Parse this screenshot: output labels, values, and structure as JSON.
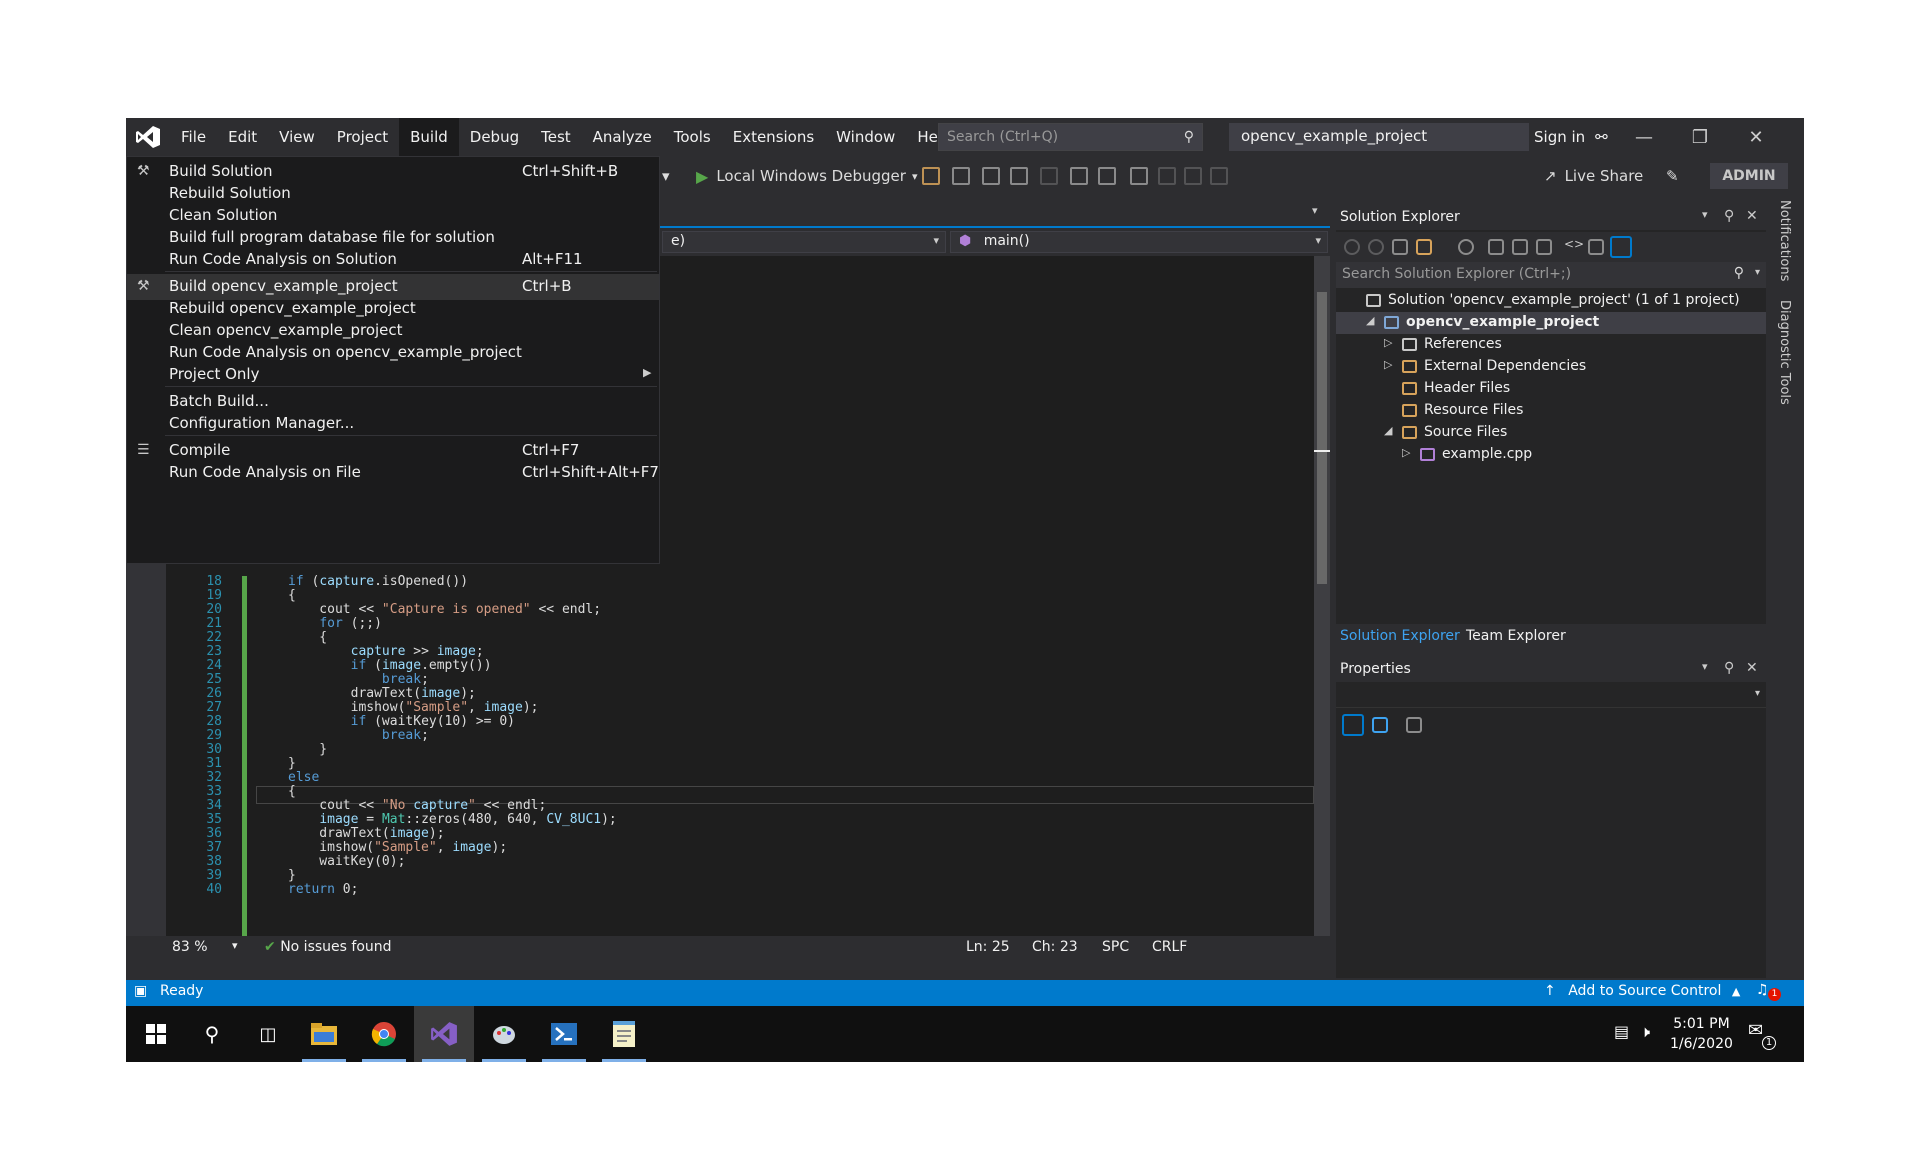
{
  "menubar": {
    "items": [
      "File",
      "Edit",
      "View",
      "Project",
      "Build",
      "Debug",
      "Test",
      "Analyze",
      "Tools",
      "Extensions",
      "Window",
      "Help"
    ],
    "search_placeholder": "Search (Ctrl+Q)",
    "project_name": "opencv_example_project",
    "sign_in": "Sign in"
  },
  "toolbar": {
    "debugger_label": "Local Windows Debugger",
    "live_share": "Live Share",
    "admin": "ADMIN"
  },
  "build_menu": {
    "items": [
      {
        "label": "Build Solution",
        "shortcut": "Ctrl+Shift+B"
      },
      {
        "label": "Rebuild Solution",
        "shortcut": ""
      },
      {
        "label": "Clean Solution",
        "shortcut": ""
      },
      {
        "label": "Build full program database file for solution",
        "shortcut": ""
      },
      {
        "label": "Run Code Analysis on Solution",
        "shortcut": "Alt+F11"
      },
      {
        "label": "Build opencv_example_project",
        "shortcut": "Ctrl+B"
      },
      {
        "label": "Rebuild opencv_example_project",
        "shortcut": ""
      },
      {
        "label": "Clean opencv_example_project",
        "shortcut": ""
      },
      {
        "label": "Run Code Analysis on opencv_example_project",
        "shortcut": ""
      },
      {
        "label": "Project Only",
        "shortcut": ""
      },
      {
        "label": "Batch Build...",
        "shortcut": ""
      },
      {
        "label": "Configuration Manager...",
        "shortcut": ""
      },
      {
        "label": "Compile",
        "shortcut": "Ctrl+F7"
      },
      {
        "label": "Run Code Analysis on File",
        "shortcut": "Ctrl+Shift+Alt+F7"
      }
    ]
  },
  "editor": {
    "nav_left": "e)",
    "nav_right": "main()",
    "code": [
      {
        "n": "18",
        "t": "if (capture.isOpened())"
      },
      {
        "n": "19",
        "t": "{"
      },
      {
        "n": "20",
        "t": "    cout << \"Capture is opened\" << endl;"
      },
      {
        "n": "21",
        "t": "    for (;;)"
      },
      {
        "n": "22",
        "t": "    {"
      },
      {
        "n": "23",
        "t": "        capture >> image;"
      },
      {
        "n": "24",
        "t": "        if (image.empty())"
      },
      {
        "n": "25",
        "t": "            break;"
      },
      {
        "n": "26",
        "t": "        drawText(image);"
      },
      {
        "n": "27",
        "t": "        imshow(\"Sample\", image);"
      },
      {
        "n": "28",
        "t": "        if (waitKey(10) >= 0)"
      },
      {
        "n": "29",
        "t": "            break;"
      },
      {
        "n": "30",
        "t": "    }"
      },
      {
        "n": "31",
        "t": "}"
      },
      {
        "n": "32",
        "t": "else"
      },
      {
        "n": "33",
        "t": "{"
      },
      {
        "n": "34",
        "t": "    cout << \"No capture\" << endl;"
      },
      {
        "n": "35",
        "t": "    image = Mat::zeros(480, 640, CV_8UC1);"
      },
      {
        "n": "36",
        "t": "    drawText(image);"
      },
      {
        "n": "37",
        "t": "    imshow(\"Sample\", image);"
      },
      {
        "n": "38",
        "t": "    waitKey(0);"
      },
      {
        "n": "39",
        "t": "}"
      },
      {
        "n": "40",
        "t": "return 0;"
      }
    ],
    "zoom": "83 %",
    "issues": "No issues found",
    "ln": "Ln: 25",
    "ch": "Ch: 23",
    "spc": "SPC",
    "crlf": "CRLF"
  },
  "solution_explorer": {
    "title": "Solution Explorer",
    "search_placeholder": "Search Solution Explorer (Ctrl+;)",
    "tree": [
      {
        "label": "Solution 'opencv_example_project' (1 of 1 project)",
        "depth": 0,
        "twisty": ""
      },
      {
        "label": "opencv_example_project",
        "depth": 1,
        "twisty": "◢"
      },
      {
        "label": "References",
        "depth": 2,
        "twisty": "▷"
      },
      {
        "label": "External Dependencies",
        "depth": 2,
        "twisty": "▷"
      },
      {
        "label": "Header Files",
        "depth": 2,
        "twisty": ""
      },
      {
        "label": "Resource Files",
        "depth": 2,
        "twisty": ""
      },
      {
        "label": "Source Files",
        "depth": 2,
        "twisty": "◢"
      },
      {
        "label": "example.cpp",
        "depth": 3,
        "twisty": "▷"
      }
    ],
    "tab_active": "Solution Explorer",
    "tab_other": "Team Explorer"
  },
  "properties": {
    "title": "Properties"
  },
  "side_tabs": {
    "notifications": "Notifications",
    "diagnostic": "Diagnostic Tools"
  },
  "statusbar": {
    "ready": "Ready",
    "source_control": "Add to Source Control",
    "badge": "1"
  },
  "taskbar": {
    "time": "5:01 PM",
    "date": "1/6/2020",
    "notif_count": "1"
  },
  "colors": {
    "accent": "#007acc",
    "menu_bg": "#1b1b1c",
    "editor_bg": "#1e1e1e",
    "vs_purple": "#865fc5"
  }
}
